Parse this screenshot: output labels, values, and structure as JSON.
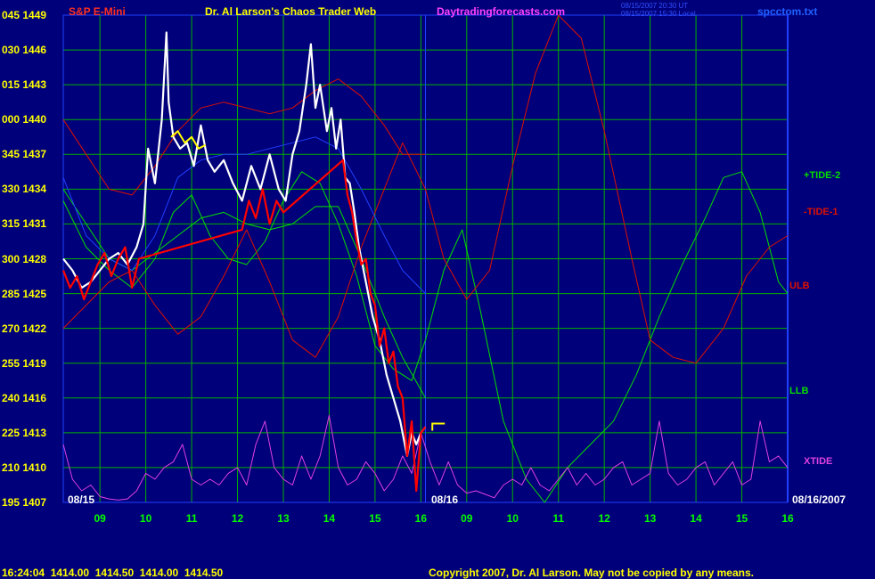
{
  "header": {
    "left": "S&P E-Mini",
    "center": "Dr. Al Larson's Chaos Trader Web",
    "site": "Daytradingforecasts.com",
    "timestamp_1": "08/15/2007 20:30 UT",
    "timestamp_2": "08/15/2007 15:30 Local",
    "file": "spcctom.txt"
  },
  "footer": {
    "quote": "16:24:04  1414.00  1414.50  1414.00  1414.50",
    "copyright": "Copyright 2007, Dr. Al Larson. May not be copied by any means."
  },
  "date_labels": {
    "left": "08/15",
    "middle": "08/16",
    "right": "08/16/2007"
  },
  "colors": {
    "background": "#00007a",
    "grid": "#00b000",
    "axis_text": "#ffff00",
    "time_text": "#00ff00",
    "tide2": "#00e000",
    "tide1": "#e01000",
    "xtide": "#e040e0",
    "avg_blue": "#2040ff",
    "price_white": "#ffffff",
    "price_red": "#ff0000",
    "price_yellow": "#ffff00"
  },
  "chart_data": {
    "type": "line",
    "title": "S&P E-Mini",
    "y_labels": [
      {
        "left": "045",
        "right": "1449",
        "value": 1449
      },
      {
        "left": "030",
        "right": "1446",
        "value": 1446
      },
      {
        "left": "015",
        "right": "1443",
        "value": 1443
      },
      {
        "left": "000",
        "right": "1440",
        "value": 1440
      },
      {
        "left": "345",
        "right": "1437",
        "value": 1437
      },
      {
        "left": "330",
        "right": "1434",
        "value": 1434
      },
      {
        "left": "315",
        "right": "1431",
        "value": 1431
      },
      {
        "left": "300",
        "right": "1428",
        "value": 1428
      },
      {
        "left": "285",
        "right": "1425",
        "value": 1425
      },
      {
        "left": "270",
        "right": "1422",
        "value": 1422
      },
      {
        "left": "255",
        "right": "1419",
        "value": 1419
      },
      {
        "left": "240",
        "right": "1416",
        "value": 1416
      },
      {
        "left": "225",
        "right": "1413",
        "value": 1413
      },
      {
        "left": "210",
        "right": "1410",
        "value": 1410
      },
      {
        "left": "195",
        "right": "1407",
        "value": 1407
      }
    ],
    "ylim": [
      1407,
      1449
    ],
    "x_ticks": [
      "09",
      "10",
      "11",
      "12",
      "13",
      "14",
      "15",
      "16",
      "09",
      "10",
      "11",
      "12",
      "13",
      "14",
      "15",
      "16"
    ],
    "xlim": [
      8.2,
      24
    ],
    "present_time": 16.1,
    "legend": [
      {
        "name": "+TIDE-2",
        "color": "#00e000"
      },
      {
        "name": "-TIDE-1",
        "color": "#e01000"
      },
      {
        "name": "ULB",
        "color": "#e01000"
      },
      {
        "name": "LLB",
        "color": "#00e000"
      },
      {
        "name": "XTIDE",
        "color": "#e040e0"
      }
    ],
    "series": [
      {
        "name": "+TIDE-2",
        "color": "#00e000",
        "x": [
          8.2,
          8.7,
          9.2,
          9.7,
          10.2,
          10.6,
          11.0,
          11.4,
          11.8,
          12.2,
          12.6,
          13.0,
          13.4,
          13.8,
          14.2,
          14.6,
          15.0,
          15.4,
          15.8,
          16.1,
          16.5,
          16.9,
          17.3,
          17.8,
          18.3,
          18.7,
          19.2,
          19.7,
          20.2,
          20.7,
          21.2,
          21.7,
          22.2,
          22.6,
          23.0,
          23.4,
          23.8,
          24.0
        ],
        "y": [
          1433,
          1429,
          1427,
          1425.5,
          1428,
          1432,
          1433.5,
          1430,
          1428,
          1427.5,
          1429.5,
          1433,
          1435.5,
          1434.5,
          1431,
          1426.5,
          1420.5,
          1418.5,
          1417.5,
          1421,
          1427,
          1430.5,
          1423.5,
          1414,
          1409,
          1407,
          1410,
          1412,
          1414,
          1418,
          1423,
          1427.5,
          1431.5,
          1435,
          1435.5,
          1432,
          1426,
          1425
        ]
      },
      {
        "name": "-TIDE-1",
        "color": "#e01000",
        "x": [
          8.2,
          8.7,
          9.2,
          9.7,
          10.2,
          10.7,
          11.2,
          11.7,
          12.2,
          12.7,
          13.2,
          13.7,
          14.2,
          14.7,
          15.2,
          15.6,
          16.1,
          16.5,
          17.0,
          17.5,
          18.0,
          18.5,
          19.0,
          19.5,
          20.0,
          20.6,
          21.0,
          21.5,
          22.0,
          22.6,
          23.1,
          23.6,
          24.0
        ],
        "y": [
          1422,
          1424,
          1426,
          1427,
          1424,
          1421.5,
          1423,
          1426.5,
          1430.5,
          1426,
          1421,
          1419.5,
          1423,
          1429,
          1434,
          1438,
          1434,
          1428,
          1424.5,
          1427,
          1436,
          1444,
          1449,
          1447,
          1439,
          1428,
          1421,
          1419.5,
          1419,
          1422,
          1426.5,
          1429,
          1430
        ]
      },
      {
        "name": "ULB",
        "color": "#e01000",
        "x": [
          8.2,
          8.7,
          9.2,
          9.7,
          10.2,
          10.7,
          11.2,
          11.7,
          12.2,
          12.7,
          13.2,
          13.7,
          14.2,
          14.7,
          15.2,
          15.6,
          16.1
        ],
        "y": [
          1440,
          1437,
          1434,
          1433.5,
          1436,
          1439,
          1441,
          1441.5,
          1441,
          1440.5,
          1441,
          1442.5,
          1443.5,
          1442,
          1439.5,
          1437,
          1437
        ]
      },
      {
        "name": "LLB",
        "color": "#00e000",
        "x": [
          8.2,
          8.7,
          9.2,
          9.7,
          10.2,
          10.7,
          11.2,
          11.7,
          12.2,
          12.7,
          13.2,
          13.7,
          14.2,
          14.7,
          15.2,
          15.6,
          16.1
        ],
        "y": [
          1434,
          1431,
          1428,
          1427,
          1428.5,
          1430,
          1431.5,
          1432,
          1431,
          1430.5,
          1431,
          1432.5,
          1432.5,
          1428,
          1423,
          1419.5,
          1416
        ]
      },
      {
        "name": "XTIDE",
        "color": "#e040e0",
        "x": [
          8.2,
          8.4,
          8.6,
          8.8,
          9.0,
          9.2,
          9.4,
          9.6,
          9.8,
          10.0,
          10.2,
          10.4,
          10.6,
          10.8,
          11.0,
          11.2,
          11.4,
          11.6,
          11.8,
          12.0,
          12.2,
          12.4,
          12.6,
          12.8,
          13.0,
          13.2,
          13.4,
          13.6,
          13.8,
          14.0,
          14.2,
          14.4,
          14.6,
          14.8,
          15.0,
          15.2,
          15.4,
          15.6,
          15.8,
          16.0,
          16.2,
          16.4,
          16.6,
          16.8,
          17.0,
          17.2,
          17.4,
          17.6,
          17.8,
          18.0,
          18.2,
          18.4,
          18.6,
          18.8,
          19.0,
          19.2,
          19.4,
          19.6,
          19.8,
          20.0,
          20.2,
          20.4,
          20.6,
          20.8,
          21.0,
          21.2,
          21.4,
          21.6,
          21.8,
          22.0,
          22.2,
          22.4,
          22.6,
          22.8,
          23.0,
          23.2,
          23.4,
          23.6,
          23.8,
          24.0
        ],
        "y": [
          1412,
          1409,
          1408,
          1408.5,
          1407.5,
          1407.3,
          1407.2,
          1407.3,
          1408,
          1409.5,
          1409,
          1410,
          1410.5,
          1412,
          1409,
          1408.5,
          1409,
          1408.5,
          1409.5,
          1410,
          1408.5,
          1412,
          1414,
          1410,
          1409,
          1408.5,
          1411,
          1409,
          1411,
          1414.5,
          1410,
          1408.5,
          1409,
          1410.5,
          1409.5,
          1408,
          1409,
          1411,
          1409.5,
          1413,
          1410.5,
          1408.5,
          1410.5,
          1408.5,
          1407.8,
          1408,
          1407.7,
          1407.4,
          1408.5,
          1409,
          1408.5,
          1410,
          1408.5,
          1408,
          1409,
          1410,
          1408.5,
          1409.5,
          1408.5,
          1409,
          1410,
          1410.5,
          1408.5,
          1409,
          1409.5,
          1414,
          1409.5,
          1408.5,
          1409,
          1410,
          1410.5,
          1408.5,
          1409.5,
          1410.5,
          1408.5,
          1409,
          1414,
          1410.5,
          1411,
          1410
        ]
      },
      {
        "name": "",
        "color": "#2040ff",
        "x": [
          8.2,
          8.7,
          9.2,
          9.7,
          10.2,
          10.7,
          11.2,
          11.7,
          12.2,
          12.7,
          13.2,
          13.7,
          14.2,
          14.7,
          15.2,
          15.6,
          16.1
        ],
        "y": [
          1435,
          1430,
          1428,
          1427,
          1430,
          1435,
          1436.5,
          1437,
          1437,
          1437.5,
          1438,
          1438.5,
          1437.5,
          1434,
          1430,
          1427,
          1425
        ]
      },
      {
        "name": "",
        "color": "#ffffff",
        "x": [
          8.2,
          8.4,
          8.6,
          8.8,
          9.0,
          9.2,
          9.4,
          9.6,
          9.8,
          9.95,
          10.05,
          10.2,
          10.35,
          10.45,
          10.5,
          10.6,
          10.75,
          10.9,
          11.05,
          11.2,
          11.35,
          11.5,
          11.7,
          11.9,
          12.1,
          12.3,
          12.5,
          12.7,
          12.9,
          13.05,
          13.2,
          13.35,
          13.5,
          13.6,
          13.7,
          13.8,
          13.95,
          14.05,
          14.15,
          14.25,
          14.35,
          14.45,
          14.55,
          14.65,
          14.8,
          14.95,
          15.1,
          15.25,
          15.4,
          15.55,
          15.7,
          15.8,
          15.9,
          16.0,
          16.1
        ],
        "y": [
          1428,
          1427,
          1425.5,
          1426,
          1427,
          1428,
          1428.5,
          1427.5,
          1429,
          1431,
          1437.5,
          1434.5,
          1440,
          1447.5,
          1441.5,
          1438.5,
          1437.5,
          1438,
          1436,
          1439.5,
          1436.5,
          1435.5,
          1436.5,
          1434.5,
          1433,
          1436,
          1434,
          1437,
          1434,
          1433,
          1437,
          1439,
          1443,
          1446.5,
          1441,
          1443,
          1439,
          1441,
          1437.5,
          1440,
          1435,
          1434.5,
          1432,
          1429,
          1426,
          1423,
          1421,
          1418,
          1416,
          1414,
          1411,
          1413,
          1412,
          1413,
          1413.5
        ]
      },
      {
        "name": "",
        "color": "#ff0000",
        "x": [
          8.2,
          8.35,
          8.5,
          8.65,
          8.8,
          8.95,
          9.1,
          9.25,
          9.4,
          9.55,
          9.7,
          9.85,
          12.1,
          12.25,
          12.4,
          12.55,
          12.7,
          12.85,
          13.0,
          14.3,
          14.4,
          14.5,
          14.6,
          14.7,
          14.8,
          14.9,
          15.0,
          15.1,
          15.2,
          15.3,
          15.4,
          15.5,
          15.6,
          15.7,
          15.8,
          15.9,
          16.0,
          16.1
        ],
        "y": [
          1427,
          1425.5,
          1426.5,
          1424.5,
          1426,
          1427.5,
          1428.5,
          1426.5,
          1428,
          1429,
          1425.5,
          1428,
          1430.5,
          1433,
          1431.5,
          1434,
          1431,
          1433,
          1432,
          1436.5,
          1433.5,
          1432,
          1429.5,
          1427.5,
          1428,
          1425,
          1424,
          1420.5,
          1422,
          1419,
          1420,
          1417,
          1416,
          1411,
          1414,
          1408,
          1413,
          1413.5
        ]
      },
      {
        "name": "",
        "color": "#ffff00",
        "x": [
          10.55,
          10.7,
          10.85,
          11.0,
          11.15,
          11.3
        ],
        "y": [
          1438.5,
          1439,
          1438,
          1438.5,
          1437.5,
          1437.8
        ]
      }
    ]
  }
}
